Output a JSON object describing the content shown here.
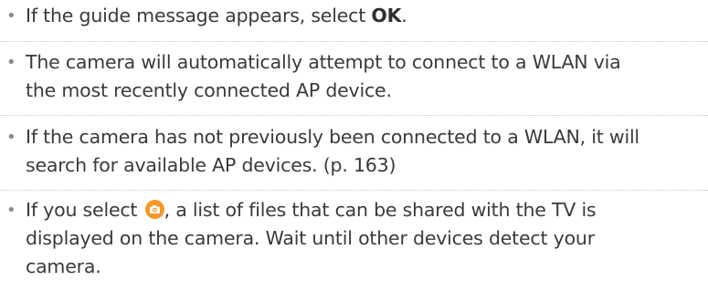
{
  "bullets": {
    "symbol": "•",
    "items": [
      {
        "pre": "If the guide message appears, select ",
        "bold": "OK",
        "post": "."
      },
      {
        "line1": "The camera will automatically attempt to connect to a WLAN via",
        "line2": "the most recently connected AP device."
      },
      {
        "line1": "If the camera has not previously been connected to a WLAN, it will",
        "line2": "search for available AP devices. (p. 163)"
      },
      {
        "line1_pre": "If you select ",
        "icon": "share-camera-icon",
        "line1_post": ", a list of files that can be shared with the TV is",
        "line2": "displayed on the camera. Wait until other devices detect your",
        "line3": "camera."
      }
    ]
  },
  "colors": {
    "text": "#3a3a3a",
    "bullet": "#8a8a8a",
    "icon": "#f39a26",
    "divider": "#c8c8c8"
  }
}
